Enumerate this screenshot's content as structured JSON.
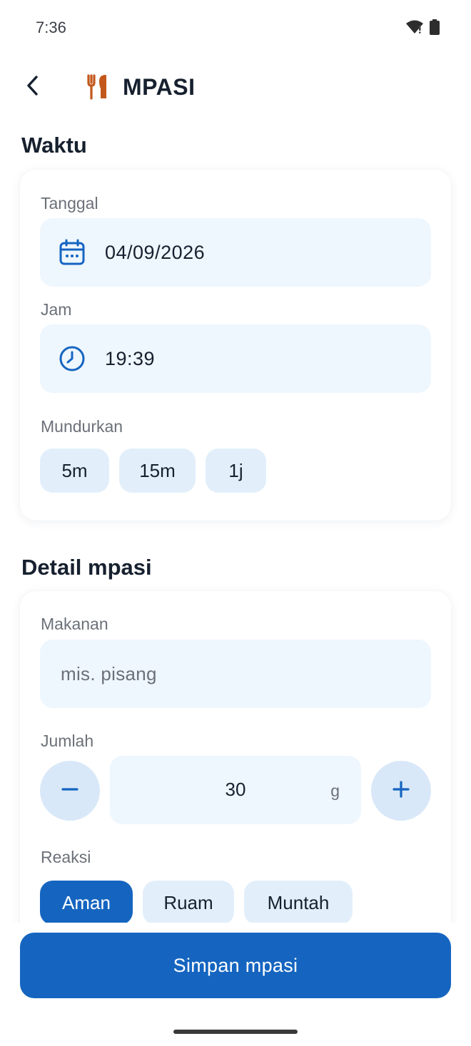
{
  "status_bar": {
    "time": "7:36",
    "icons": [
      "wifi-icon",
      "battery-icon"
    ]
  },
  "app_bar": {
    "title": "MPASI",
    "back_icon": "back-arrow-icon",
    "app_icon": "utensils-icon",
    "app_icon_color": "#c2581b"
  },
  "waktu": {
    "section_title": "Waktu",
    "tanggal_label": "Tanggal",
    "tanggal_value": "04/09/2026",
    "jam_label": "Jam",
    "jam_value": "19:39",
    "mundurkan_label": "Mundurkan",
    "offset_chips": [
      "5m",
      "15m",
      "1j"
    ]
  },
  "detail": {
    "section_title": "Detail mpasi",
    "makanan_label": "Makanan",
    "makanan_placeholder": "mis. pisang",
    "jumlah_label": "Jumlah",
    "jumlah_value": "30",
    "jumlah_unit": "g",
    "reaksi_label": "Reaksi",
    "reaksi_options": [
      "Aman",
      "Ruam",
      "Muntah"
    ],
    "reaksi_selected": "Aman"
  },
  "save_button_label": "Simpan mpasi",
  "colors": {
    "accent": "#1565c0",
    "field_bg": "#eef6fe",
    "chip_bg": "#e2effb"
  }
}
